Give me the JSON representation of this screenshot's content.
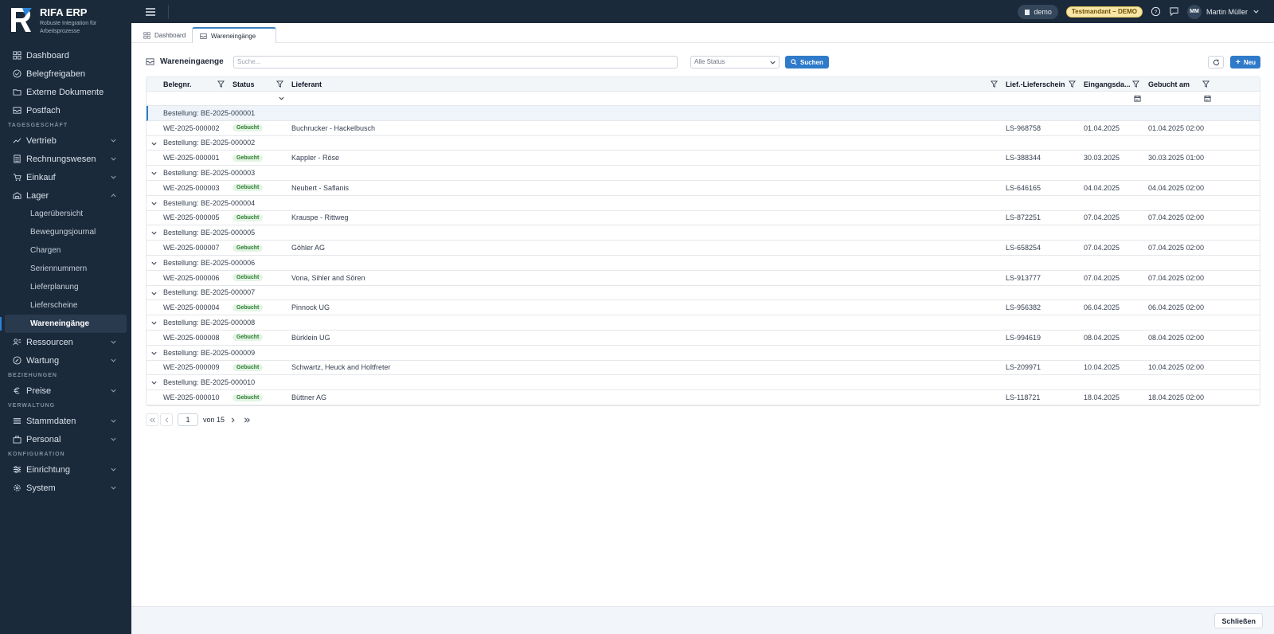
{
  "brand": {
    "name": "RIFA ERP",
    "subtitle": "Robuste Integration für Arbeitsprozesse"
  },
  "sidebar": {
    "top_items": [
      {
        "label": "Dashboard",
        "icon": "dashboard-icon"
      },
      {
        "label": "Belegfreigaben",
        "icon": "check-circle-icon"
      },
      {
        "label": "Externe Dokumente",
        "icon": "folder-icon"
      },
      {
        "label": "Postfach",
        "icon": "inbox-icon"
      }
    ],
    "section_tagesgeschaeft": "TAGESGESCHÄFT",
    "tages_items": [
      {
        "label": "Vertrieb",
        "icon": "trend-icon"
      },
      {
        "label": "Rechnungswesen",
        "icon": "calculator-icon"
      },
      {
        "label": "Einkauf",
        "icon": "cart-icon"
      },
      {
        "label": "Lager",
        "icon": "warehouse-icon"
      }
    ],
    "lager_sub": [
      "Lagerübersicht",
      "Bewegungsjournal",
      "Chargen",
      "Seriennummern",
      "Lieferplanung",
      "Lieferscheine",
      "Wareneingänge"
    ],
    "after_lager": [
      {
        "label": "Ressourcen",
        "icon": "resources-icon"
      },
      {
        "label": "Wartung",
        "icon": "wrench-icon"
      }
    ],
    "section_beziehungen": "BEZIEHUNGEN",
    "bez_items": [
      {
        "label": "Preise",
        "icon": "euro-icon"
      }
    ],
    "section_verwaltung": "VERWALTUNG",
    "verw_items": [
      {
        "label": "Stammdaten",
        "icon": "list-icon"
      },
      {
        "label": "Personal",
        "icon": "briefcase-icon"
      }
    ],
    "section_konfiguration": "KONFIGURATION",
    "konf_items": [
      {
        "label": "Einrichtung",
        "icon": "sliders-icon"
      },
      {
        "label": "System",
        "icon": "gear-icon"
      }
    ]
  },
  "topbar": {
    "tenant": "demo",
    "badge": "Testmandant – DEMO",
    "user_initials": "MM",
    "user_name": "Martin Müller"
  },
  "tabs": [
    {
      "label": "Dashboard"
    },
    {
      "label": "Wareneingänge"
    }
  ],
  "toolbar": {
    "title": "Wareneingaenge",
    "search_placeholder": "Suche...",
    "status_value": "Alle Status",
    "search_button": "Suchen",
    "new_button": "Neu"
  },
  "table": {
    "columns": [
      "Belegnr.",
      "Status",
      "Lieferant",
      "Lief.-Lieferschein",
      "Eingangsda...",
      "Gebucht am"
    ],
    "groups": [
      {
        "label": "Bestellung: BE-2025-000001",
        "row": {
          "nr": "WE-2025-000002",
          "status": "Gebucht",
          "lieferant": "Buchrucker - Hackelbusch",
          "ls": "LS-968758",
          "eingang": "01.04.2025",
          "gebucht": "01.04.2025 02:00"
        }
      },
      {
        "label": "Bestellung: BE-2025-000002",
        "row": {
          "nr": "WE-2025-000001",
          "status": "Gebucht",
          "lieferant": "Kappler - Röse",
          "ls": "LS-388344",
          "eingang": "30.03.2025",
          "gebucht": "30.03.2025 01:00"
        }
      },
      {
        "label": "Bestellung: BE-2025-000003",
        "row": {
          "nr": "WE-2025-000003",
          "status": "Gebucht",
          "lieferant": "Neubert - Saflanis",
          "ls": "LS-646165",
          "eingang": "04.04.2025",
          "gebucht": "04.04.2025 02:00"
        }
      },
      {
        "label": "Bestellung: BE-2025-000004",
        "row": {
          "nr": "WE-2025-000005",
          "status": "Gebucht",
          "lieferant": "Krauspe - Rittweg",
          "ls": "LS-872251",
          "eingang": "07.04.2025",
          "gebucht": "07.04.2025 02:00"
        }
      },
      {
        "label": "Bestellung: BE-2025-000005",
        "row": {
          "nr": "WE-2025-000007",
          "status": "Gebucht",
          "lieferant": "Göhler AG",
          "ls": "LS-658254",
          "eingang": "07.04.2025",
          "gebucht": "07.04.2025 02:00"
        }
      },
      {
        "label": "Bestellung: BE-2025-000006",
        "row": {
          "nr": "WE-2025-000006",
          "status": "Gebucht",
          "lieferant": "Vona, Sihler and Sören",
          "ls": "LS-913777",
          "eingang": "07.04.2025",
          "gebucht": "07.04.2025 02:00"
        }
      },
      {
        "label": "Bestellung: BE-2025-000007",
        "row": {
          "nr": "WE-2025-000004",
          "status": "Gebucht",
          "lieferant": "Pinnock UG",
          "ls": "LS-956382",
          "eingang": "06.04.2025",
          "gebucht": "06.04.2025 02:00"
        }
      },
      {
        "label": "Bestellung: BE-2025-000008",
        "row": {
          "nr": "WE-2025-000008",
          "status": "Gebucht",
          "lieferant": "Bürklein UG",
          "ls": "LS-994619",
          "eingang": "08.04.2025",
          "gebucht": "08.04.2025 02:00"
        }
      },
      {
        "label": "Bestellung: BE-2025-000009",
        "row": {
          "nr": "WE-2025-000009",
          "status": "Gebucht",
          "lieferant": "Schwartz, Heuck and Holtfreter",
          "ls": "LS-209971",
          "eingang": "10.04.2025",
          "gebucht": "10.04.2025 02:00"
        }
      },
      {
        "label": "Bestellung: BE-2025-000010",
        "row": {
          "nr": "WE-2025-000010",
          "status": "Gebucht",
          "lieferant": "Büttner AG",
          "ls": "LS-118721",
          "eingang": "18.04.2025",
          "gebucht": "18.04.2025 02:00"
        }
      }
    ]
  },
  "pager": {
    "page": "1",
    "of_label": "von 15"
  },
  "footer": {
    "close_label": "Schließen"
  },
  "colors": {
    "sidebar_bg": "#1b2a3b",
    "accent": "#2f7ac9",
    "badge_green": "#2e7d32"
  }
}
